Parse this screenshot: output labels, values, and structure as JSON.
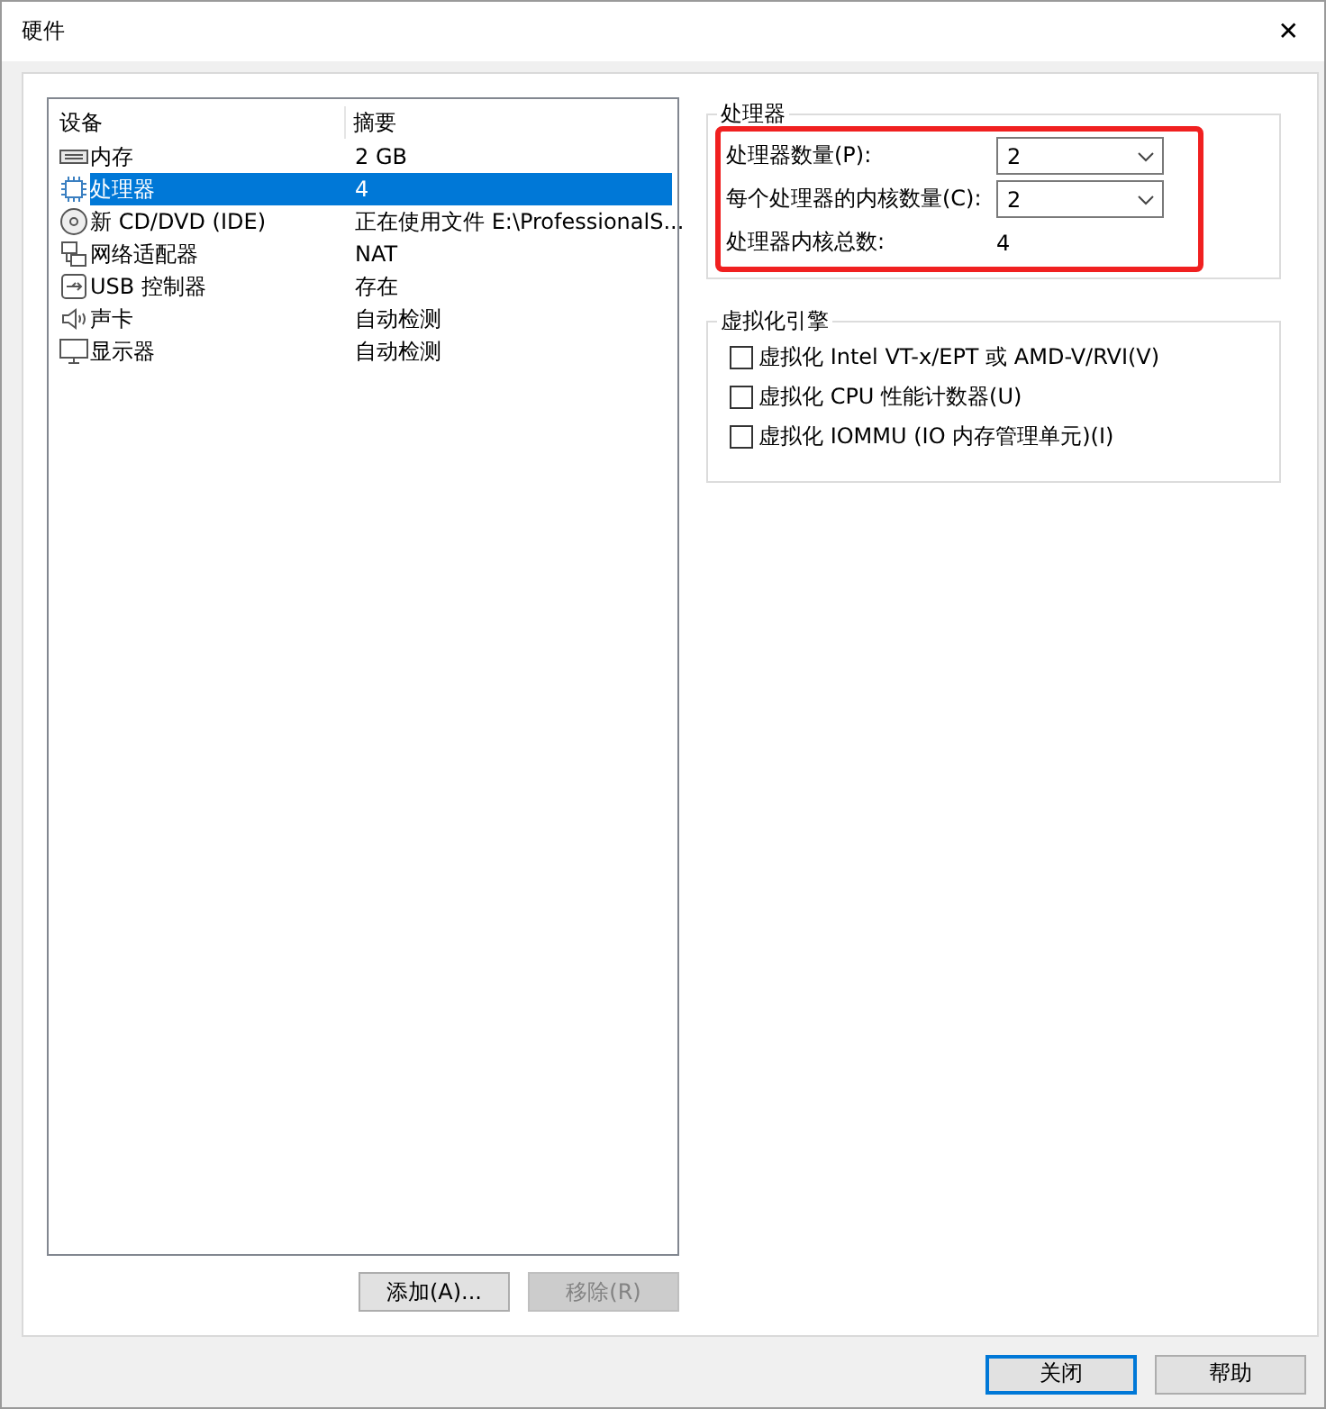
{
  "window": {
    "title": "硬件",
    "close": "✕"
  },
  "devices": {
    "columns": [
      "设备",
      "摘要"
    ],
    "rows": [
      {
        "kind": "memory",
        "name": "内存",
        "summary": "2 GB",
        "selected": false
      },
      {
        "kind": "cpu",
        "name": "处理器",
        "summary": "4",
        "selected": true
      },
      {
        "kind": "disc",
        "name": "新 CD/DVD (IDE)",
        "summary": "正在使用文件 E:\\ProfessionalS...",
        "selected": false
      },
      {
        "kind": "network",
        "name": "网络适配器",
        "summary": "NAT",
        "selected": false
      },
      {
        "kind": "usb",
        "name": "USB 控制器",
        "summary": "存在",
        "selected": false
      },
      {
        "kind": "sound",
        "name": "声卡",
        "summary": "自动检测",
        "selected": false
      },
      {
        "kind": "display",
        "name": "显示器",
        "summary": "自动检测",
        "selected": false
      }
    ]
  },
  "list_buttons": [
    {
      "label": "添加(A)...",
      "disabled": false
    },
    {
      "label": "移除(R)",
      "disabled": true
    }
  ],
  "processor": {
    "title": "处理器",
    "highlighted": true,
    "fields": [
      {
        "kind": "select",
        "label": "处理器数量(P):",
        "value": "2"
      },
      {
        "kind": "select",
        "label": "每个处理器的内核数量(C):",
        "value": "2"
      },
      {
        "kind": "readout",
        "label": "处理器内核总数:",
        "value": "4"
      }
    ]
  },
  "virtualization": {
    "title": "虚拟化引擎",
    "options": [
      {
        "label": "虚拟化 Intel VT-x/EPT 或 AMD-V/RVI(V)",
        "checked": false
      },
      {
        "label": "虚拟化 CPU 性能计数器(U)",
        "checked": false
      },
      {
        "label": "虚拟化 IOMMU (IO 内存管理单元)(I)",
        "checked": false
      }
    ]
  },
  "footer_buttons": [
    {
      "label": "关闭",
      "default": true
    },
    {
      "label": "帮助",
      "default": false
    }
  ]
}
